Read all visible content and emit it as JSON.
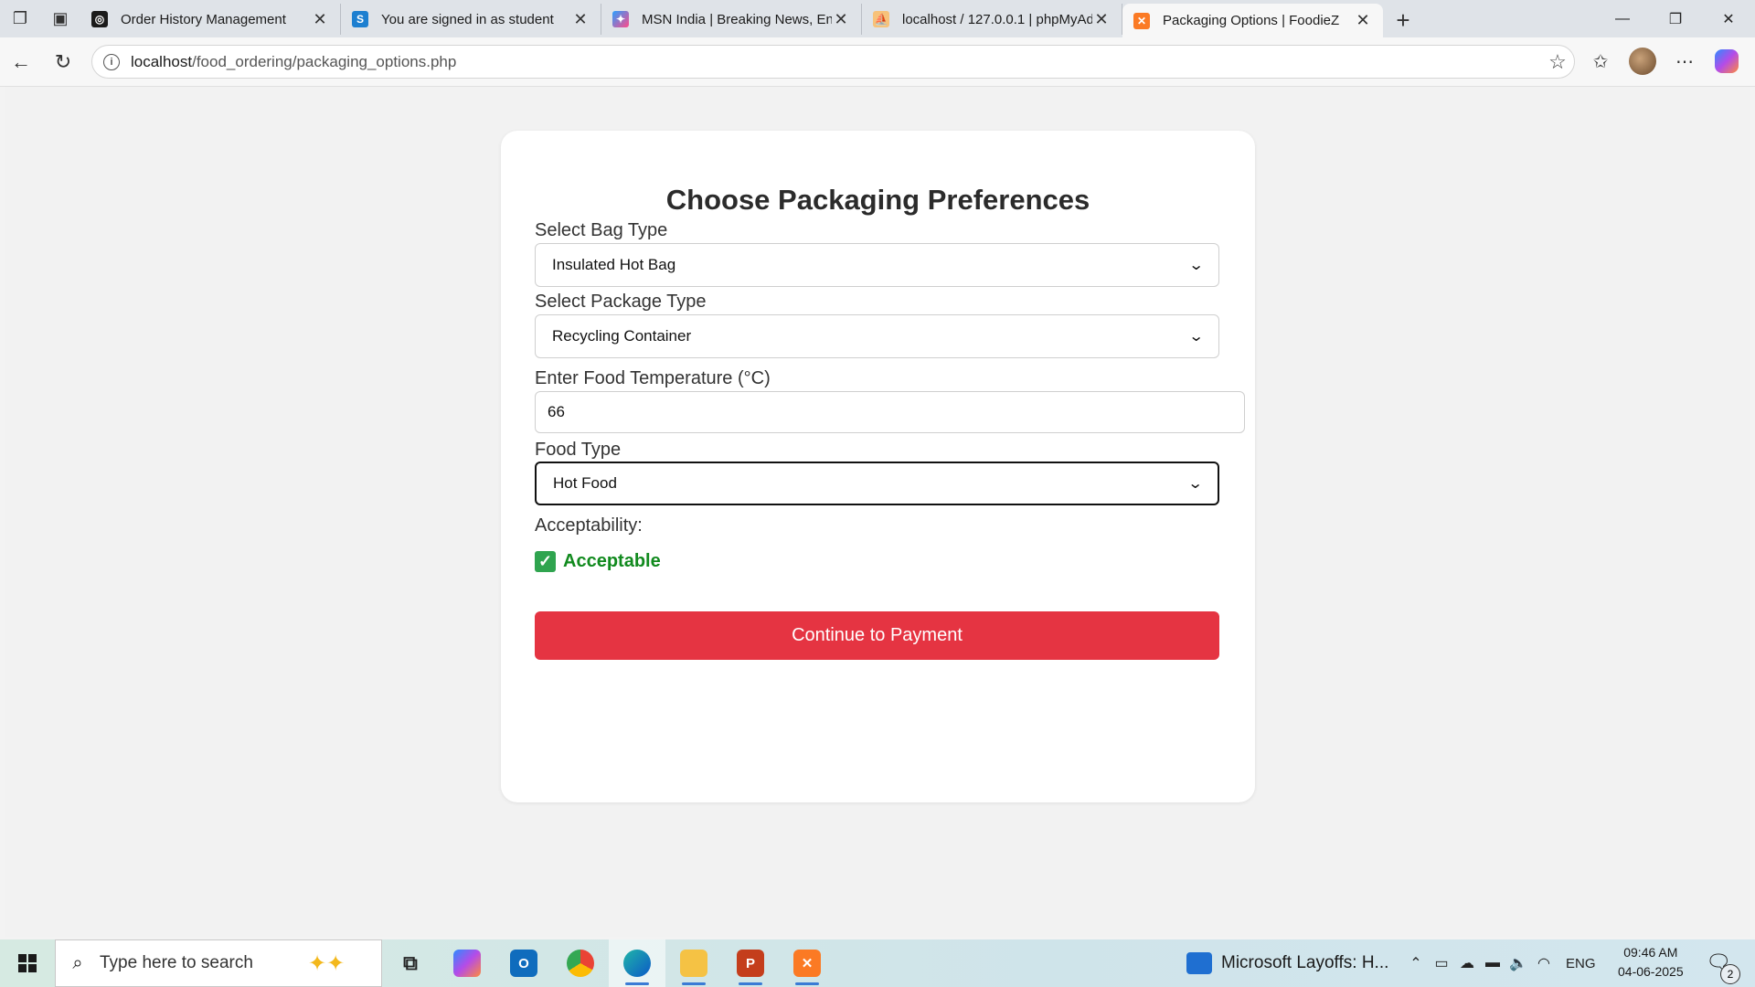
{
  "browser": {
    "tabs": [
      {
        "title": "Order History Management",
        "favicon": "globe-icon",
        "favicon_color": "#1b1b1b",
        "favicon_glyph": "◎"
      },
      {
        "title": "You are signed in as student",
        "favicon": "s-icon",
        "favicon_color": "#1d7fd0",
        "favicon_glyph": "S"
      },
      {
        "title": "MSN India | Breaking News, Enter",
        "favicon": "msn-butterfly-icon",
        "favicon_color": "#ff4a8a",
        "favicon_glyph": "✦"
      },
      {
        "title": "localhost / 127.0.0.1 | phpMyAdm",
        "favicon": "phpmyadmin-icon",
        "favicon_color": "#f39c12",
        "favicon_glyph": "⛵"
      },
      {
        "title": "Packaging Options | FoodieZ",
        "favicon": "xampp-icon",
        "favicon_color": "#fb7a24",
        "favicon_glyph": "✕"
      }
    ],
    "url_host": "localhost",
    "url_path": "/food_ordering/packaging_options.php"
  },
  "form": {
    "title": "Choose Packaging Preferences",
    "bag_label": "Select Bag Type",
    "bag_value": "Insulated Hot Bag",
    "package_label": "Select Package Type",
    "package_value": "Recycling Container",
    "temp_label": "Enter Food Temperature (°C)",
    "temp_value": "66",
    "food_label": "Food Type",
    "food_value": "Hot Food",
    "accept_label": "Acceptability:",
    "accept_status": "Acceptable",
    "continue_label": "Continue to Payment"
  },
  "taskbar": {
    "search_placeholder": "Type here to search",
    "news_text": "Microsoft Layoffs: H...",
    "language": "ENG",
    "time": "09:46 AM",
    "date": "04-06-2025",
    "notification_count": "2"
  },
  "colors": {
    "accent_button": "#e53442",
    "accept_green": "#118a1e"
  }
}
